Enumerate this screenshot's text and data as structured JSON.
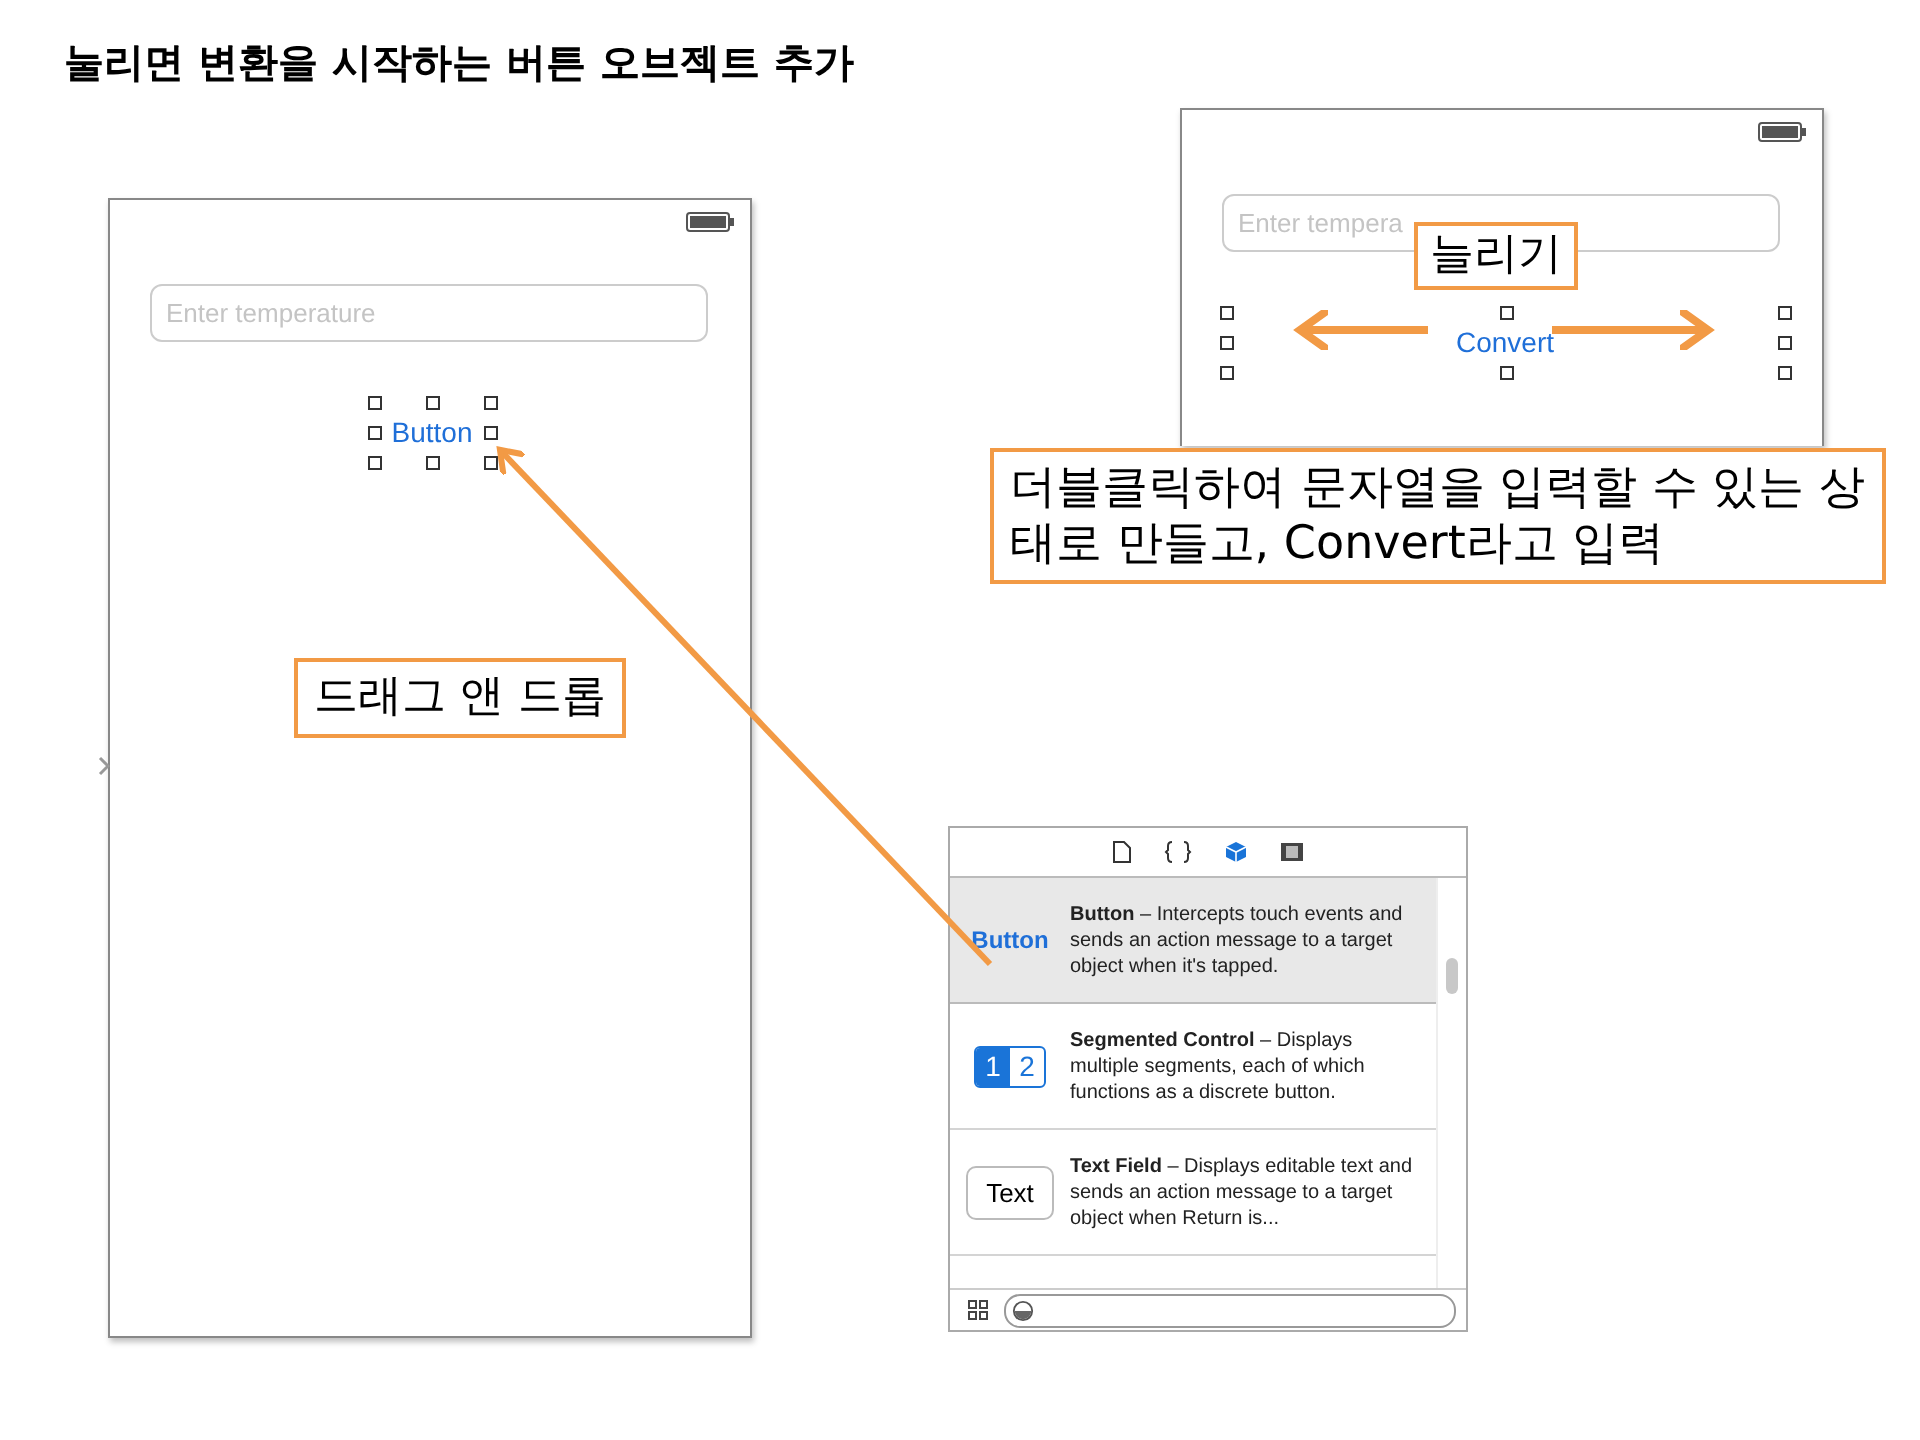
{
  "title": "눌리면 변환을 시작하는 버튼 오브젝트 추가",
  "before_screen": {
    "text_field": {
      "placeholder": "Enter temperature"
    },
    "button": {
      "label": "Button",
      "selected": true
    }
  },
  "after_screen": {
    "text_field": {
      "placeholder": "Enter tempera"
    },
    "button": {
      "label": "Convert",
      "selected": true
    }
  },
  "callouts": [
    {
      "text": "드래그 앤 드롭"
    },
    {
      "text": "늘리기"
    },
    {
      "text": "더블클릭하여 문자열을 입력할 수 있는 상태로 만들고, Convert라고 입력"
    }
  ],
  "library": {
    "tabs": [
      {
        "kind": "file",
        "selected": false
      },
      {
        "kind": "code",
        "selected": false
      },
      {
        "kind": "object",
        "selected": true
      },
      {
        "kind": "media",
        "selected": false
      }
    ],
    "items": [
      {
        "kind": "button",
        "preview": [
          "Button"
        ],
        "description": "**Button** – Intercepts touch events and sends an action message to a target object when it's tapped.",
        "selected": true
      },
      {
        "kind": "segmented",
        "preview": [
          "1",
          "2"
        ],
        "description": "**Segmented Control** – Displays multiple segments, each of which functions as a discrete button.",
        "selected": false
      },
      {
        "kind": "text_field",
        "preview": [
          "Text"
        ],
        "description": "**Text Field** – Displays editable text and sends an action message to a target object when Return is...",
        "selected": false
      }
    ]
  }
}
